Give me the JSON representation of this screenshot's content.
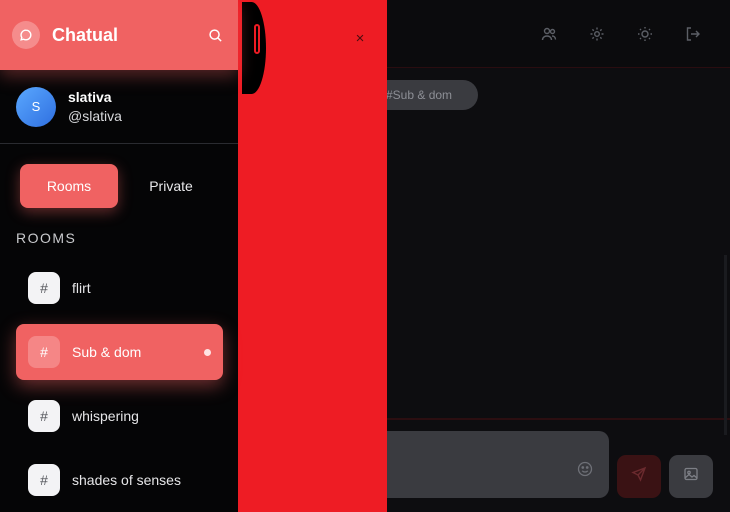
{
  "app": {
    "title": "Chatual"
  },
  "user": {
    "avatar_initial": "S",
    "name": "slativa",
    "handle": "@slativa"
  },
  "tabs": {
    "rooms": "Rooms",
    "private": "Private"
  },
  "rooms_section": {
    "label": "ROOMS",
    "items": [
      {
        "label": "flirt",
        "icon": "#",
        "active": false
      },
      {
        "label": "Sub & dom",
        "icon": "#",
        "active": true
      },
      {
        "label": "whispering",
        "icon": "#",
        "active": false
      },
      {
        "label": "shades of senses",
        "icon": "#",
        "active": false
      }
    ]
  },
  "background_chat": {
    "room_chip": "#Sub & dom",
    "close_glyph": "×"
  },
  "colors": {
    "accent": "#f06262",
    "overlay_red": "#ee1c24",
    "sidebar_bg": "#050506",
    "avatar_blue": "#3b82f6"
  },
  "icons": {
    "logo": "chat-bubble-icon",
    "search": "search-icon",
    "users": "users-icon",
    "settings": "gear-icon",
    "theme": "sun-icon",
    "logout": "logout-icon",
    "emoji": "smiley-icon",
    "send": "send-icon",
    "image": "image-icon"
  }
}
